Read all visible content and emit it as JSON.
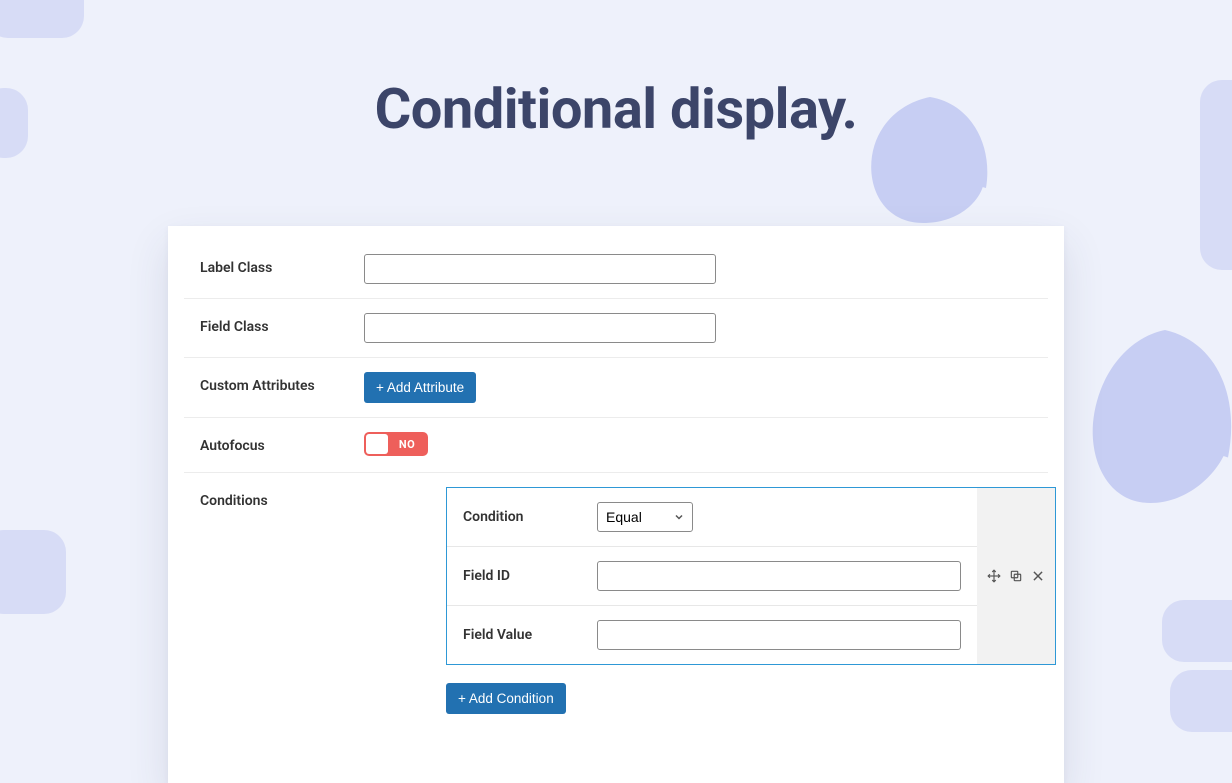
{
  "page": {
    "title": "Conditional display."
  },
  "form": {
    "label_class": {
      "label": "Label Class",
      "value": ""
    },
    "field_class": {
      "label": "Field Class",
      "value": ""
    },
    "custom_attributes": {
      "label": "Custom Attributes",
      "button": "+ Add Attribute"
    },
    "autofocus": {
      "label": "Autofocus",
      "value_text": "NO",
      "state": false
    },
    "conditions": {
      "label": "Conditions",
      "add_button": "+ Add Condition",
      "item": {
        "condition_label": "Condition",
        "condition_value": "Equal",
        "field_id_label": "Field ID",
        "field_id_value": "",
        "field_value_label": "Field Value",
        "field_value_value": ""
      }
    }
  }
}
